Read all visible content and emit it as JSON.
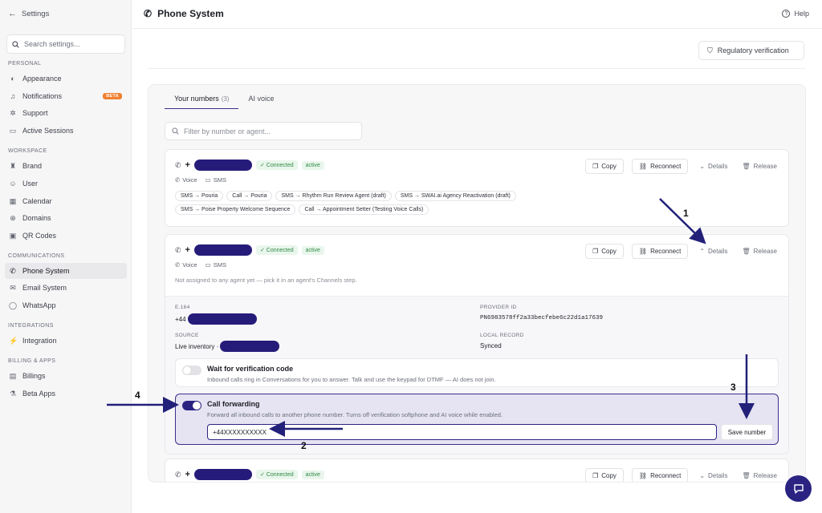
{
  "sidebar": {
    "back_label": "Settings",
    "search_placeholder": "Search settings...",
    "sections": {
      "personal": "PERSONAL",
      "workspace": "WORKSPACE",
      "communications": "COMMUNICATIONS",
      "integrations": "INTEGRATIONS",
      "billing": "BILLING & APPS"
    },
    "items": {
      "appearance": "Appearance",
      "notifications": "Notifications",
      "notifications_badge": "BETA",
      "support": "Support",
      "active_sessions": "Active Sessions",
      "brand": "Brand",
      "user": "User",
      "calendar": "Calendar",
      "domains": "Domains",
      "qr_codes": "QR Codes",
      "phone_system": "Phone System",
      "email_system": "Email System",
      "whatsapp": "WhatsApp",
      "integration": "Integration",
      "billings": "Billings",
      "beta_apps": "Beta Apps"
    }
  },
  "header": {
    "title": "Phone System",
    "help_label": "Help"
  },
  "regulatory_button": "Regulatory verification",
  "tabs": {
    "numbers": "Your numbers",
    "numbers_count": "(3)",
    "ai_voice": "AI voice"
  },
  "filter_placeholder": "Filter by number or agent...",
  "card_common": {
    "plus": "+",
    "connected": "✓ Connected",
    "active": "active",
    "voice": "Voice",
    "sms": "SMS",
    "copy": "Copy",
    "reconnect": "Reconnect",
    "details": "Details",
    "release": "Release"
  },
  "card1": {
    "chips": [
      "SMS → Pouria",
      "Call → Pouria",
      "SMS → Rhythm Run Review Agent (draft)",
      "SMS → SWAI.ai Agency Reactivation (draft)",
      "SMS → Poise Property Welcome Sequence",
      "Call → Appointment Setter (Testing Voice Calls)"
    ]
  },
  "card2": {
    "note": "Not assigned to any agent yet — pick it in an agent's Channels step.",
    "details": {
      "e164_label": "E.164",
      "e164_prefix": "+44",
      "provider_label": "PROVIDER ID",
      "provider_value": "PN6983578ff2a33becfebe6c22d1a17639",
      "source_label": "SOURCE",
      "source_value": "Live inventory · ",
      "local_label": "LOCAL RECORD",
      "local_value": "Synced"
    },
    "wait_title": "Wait for verification code",
    "wait_desc": "Inbound calls ring in Conversations for you to answer. Talk and use the keypad for DTMF — AI does not join.",
    "forward_title": "Call forwarding",
    "forward_desc": "Forward all inbound calls to another phone number. Turns off verification softphone and AI voice while enabled.",
    "forward_value": "+44XXXXXXXXXX",
    "save_label": "Save number"
  },
  "annotations": {
    "a1": "1",
    "a2": "2",
    "a3": "3",
    "a4": "4"
  },
  "colors": {
    "accent": "#2a2382",
    "redaction": "#251c7a",
    "success": "#2f8a45",
    "beta_badge": "#f08030"
  }
}
